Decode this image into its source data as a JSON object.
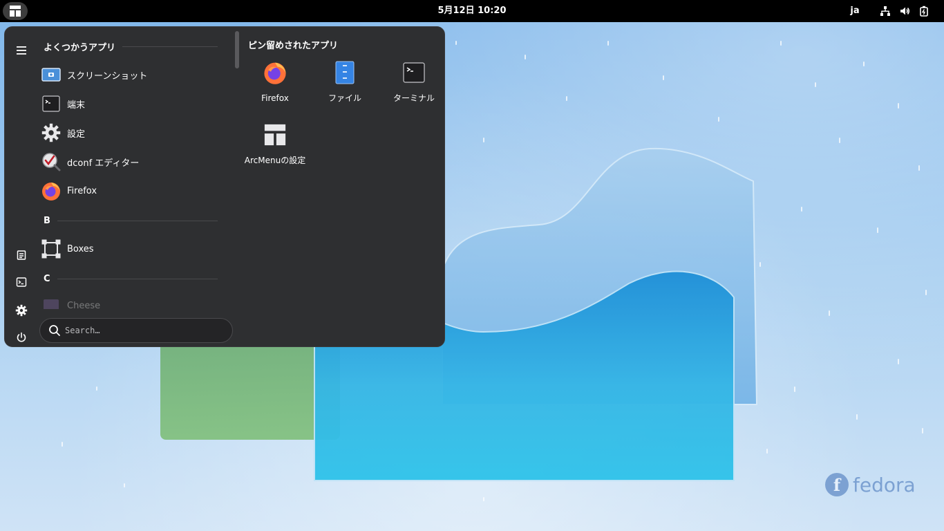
{
  "topbar": {
    "clock": "5月12日  10:20",
    "language": "ja",
    "tray_icons": [
      "network-icon",
      "volume-icon",
      "battery-icon"
    ]
  },
  "menu": {
    "frequent_heading": "よくつかうアプリ",
    "frequent_apps": [
      {
        "label": "スクリーンショット",
        "icon": "screenshot-icon"
      },
      {
        "label": "端末",
        "icon": "terminal-icon"
      },
      {
        "label": "設定",
        "icon": "settings-icon"
      },
      {
        "label": "dconf エディター",
        "icon": "dconf-editor-icon"
      },
      {
        "label": "Firefox",
        "icon": "firefox-icon"
      }
    ],
    "section_b": "B",
    "b_apps": [
      {
        "label": "Boxes",
        "icon": "boxes-icon"
      }
    ],
    "section_c": "C",
    "c_apps": [
      {
        "label": "Cheese",
        "icon": "cheese-icon"
      }
    ],
    "pinned_heading": "ピン留めされたアプリ",
    "pinned_apps": [
      {
        "label": "Firefox",
        "icon": "firefox-icon"
      },
      {
        "label": "ファイル",
        "icon": "files-icon"
      },
      {
        "label": "ターミナル",
        "icon": "terminal-icon"
      },
      {
        "label": "ArcMenuの設定",
        "icon": "arcmenu-settings-icon"
      }
    ],
    "search_placeholder": "Search…"
  },
  "desktop": {
    "logo_text": "fedora"
  },
  "colors": {
    "topbar": "#000000",
    "menu_bg": "#2e2f31",
    "firefox_orange": "#ff7139",
    "files_blue": "#3584e4"
  }
}
